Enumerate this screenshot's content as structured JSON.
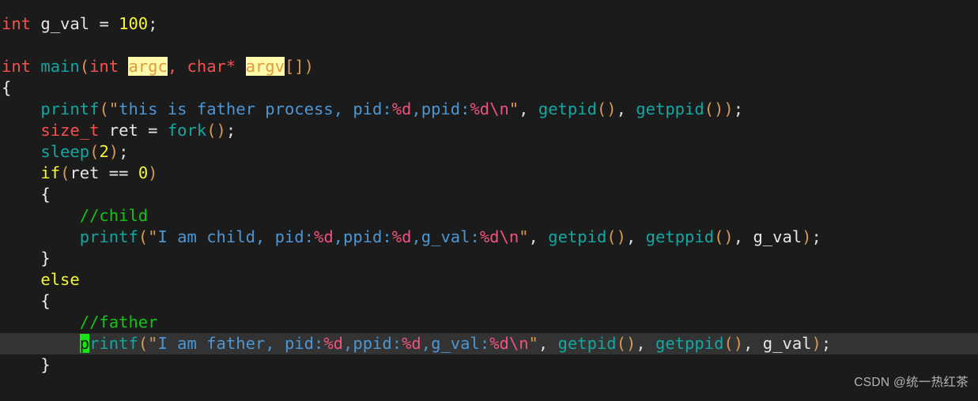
{
  "editor": {
    "background_color": "#1b1b1b",
    "cursor_line_color": "#333333",
    "cursor_color": "#16e616",
    "font_size_px": 20.5,
    "language": "c",
    "cursor_line_number": 17,
    "cursor_char": "p"
  },
  "colors": {
    "type": "#f4524f",
    "identifier": "#e6e6e6",
    "number": "#f7f733",
    "keyword": "#f7f733",
    "function": "#11a8a1",
    "string": "#4d96d4",
    "escape": "#f0527f",
    "comment": "#13c513",
    "parameter_text": "#e09b3c",
    "parameter_highlight": "#fdfaac",
    "paren": "#d79a54",
    "brace": "#e8eef5"
  },
  "code": {
    "line_01": "int g_val = 100;",
    "line_02": "",
    "line_03": "int main(int argc, char* argv[])",
    "line_04": "{",
    "line_05": "    printf(\"this is father process, pid:%d,ppid:%d\\n\", getpid(), getppid());",
    "line_06": "    size_t ret = fork();",
    "line_07": "    sleep(2);",
    "line_08": "    if(ret == 0)",
    "line_09": "    {",
    "line_10": "        //child",
    "line_11": "        printf(\"I am child, pid:%d,ppid:%d,g_val:%d\\n\", getpid(), getppid(), g_val);",
    "line_12": "    }",
    "line_13": "    else",
    "line_14": "    {",
    "line_15": "        //father",
    "line_16": "        printf(\"I am father, pid:%d,ppid:%d,g_val:%d\\n\", getpid(), getppid(), g_val);",
    "line_17": "    }"
  },
  "tokens": {
    "kw_int": "int",
    "id_g_val": " g_val ",
    "op_assign": "=",
    "num_100": " 100",
    "semi": ";",
    "fn_main": "main",
    "paren_open": "(",
    "paren_close": ")",
    "kw_int2": "int",
    "param_argc": "argc",
    "comma_sp": ", ",
    "kw_char": "char*",
    "param_argv": "argv",
    "brackets": "[]",
    "brace_open": "{",
    "brace_close": "}",
    "indent4": "    ",
    "indent8": "        ",
    "fn_printf": "printf",
    "quote": "\"",
    "str_father_header": "this is father process, pid:",
    "esc_d": "%d",
    "str_comma_ppid": ",ppid:",
    "esc_n": "\\n",
    "arg_sep": ", ",
    "fn_getpid": "getpid",
    "fn_getppid": "getppid",
    "empty_parens": "()",
    "type_size_t": "size_t",
    "id_ret": " ret ",
    "fn_fork": "fork",
    "fn_sleep": "sleep",
    "num_2": "2",
    "kw_if": "if",
    "id_ret2": "ret",
    "op_eq": " == ",
    "num_0": "0",
    "comment_child": "//child",
    "comment_father": "//father",
    "kw_else": "else",
    "str_i_am_child": "I am child, pid:",
    "str_i_am_father": "I am father, pid:",
    "str_g_val_label": ",g_val:",
    "id_g_val_arg": " g_val",
    "cursor_char": "p",
    "printf_rest": "rintf"
  },
  "watermark": {
    "text": "CSDN @统一热红茶"
  }
}
